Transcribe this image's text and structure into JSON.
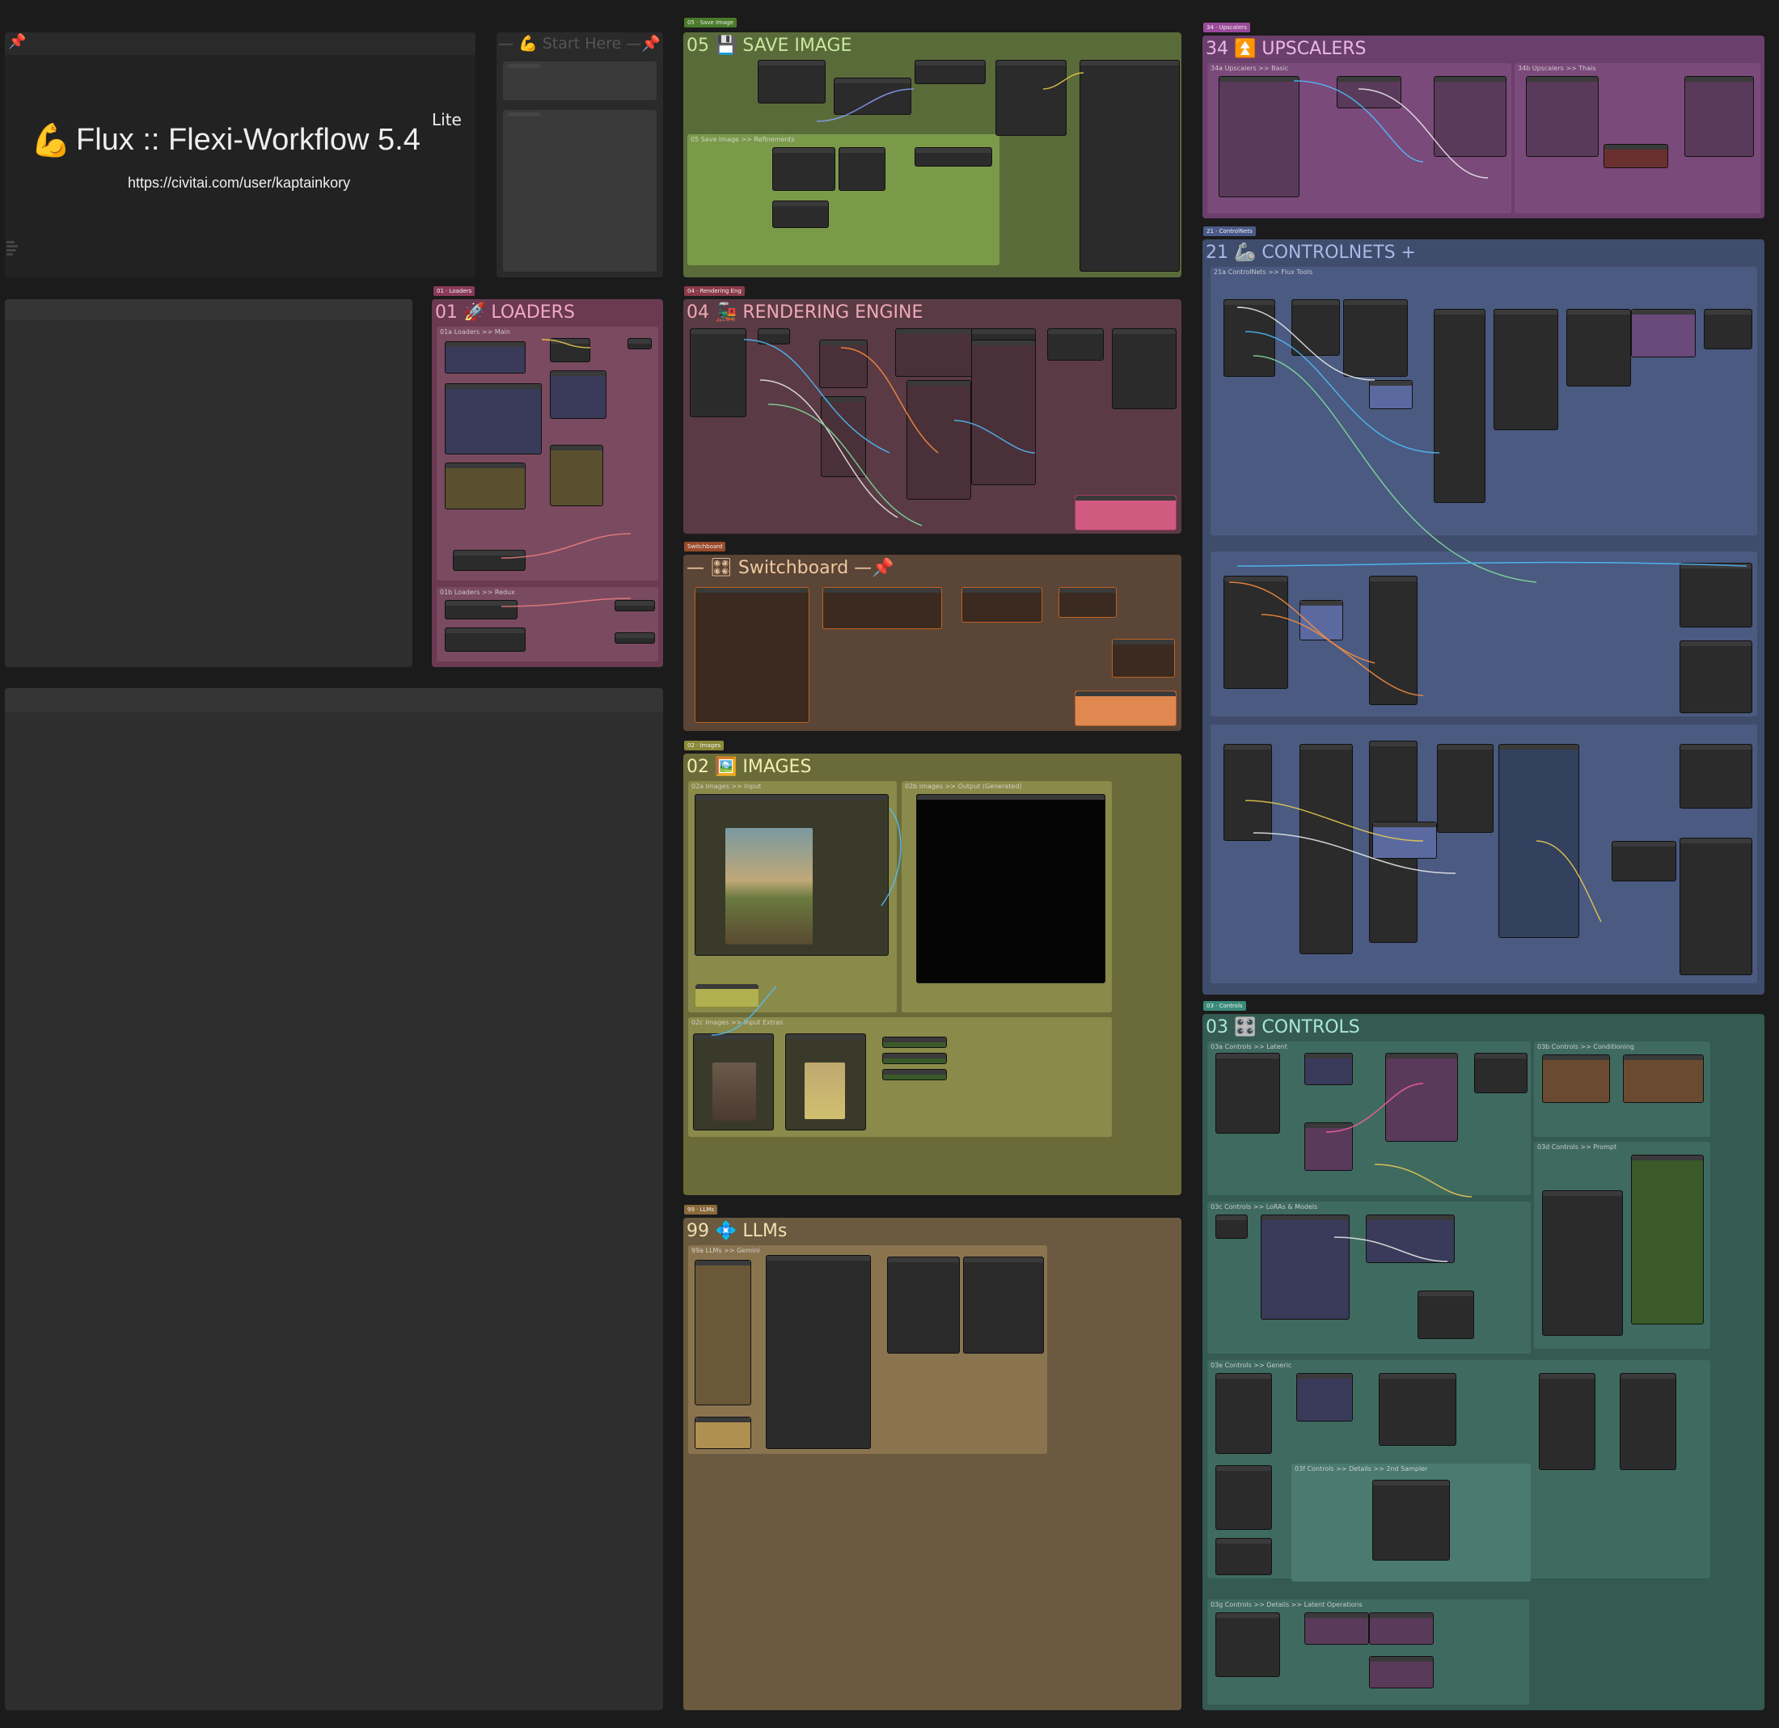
{
  "title_card": {
    "pin": "📌",
    "emoji": "💪",
    "title": "Flux :: Flexi-Workflow 5.4",
    "edition": "Lite",
    "url": "https://civitai.com/user/kaptainkory"
  },
  "start_here": {
    "label": "— 💪 Start Here —📌"
  },
  "groups": {
    "save_image": {
      "title": "05 💾 SAVE IMAGE",
      "sub1": "05 Save Image >> Refinements"
    },
    "upscalers": {
      "title": "34 ⏫ UPSCALERS",
      "sub1": "34a Upscalers >> Basic",
      "sub2": "34b Upscalers >> Thais"
    },
    "controlnets": {
      "title": "21 🦾 CONTROLNETS +",
      "sub1": "21a ControlNets >> Flux Tools"
    },
    "loaders": {
      "title": "01 🚀 LOADERS",
      "sub1": "01a Loaders >> Main",
      "sub2": "01b Loaders >> Redux"
    },
    "rendering": {
      "title": "04 🚂 RENDERING ENGINE"
    },
    "switchboard": {
      "title": "— 🎛 Switchboard —📌"
    },
    "images": {
      "title": "02 🖼️ IMAGES",
      "sub1": "02a Images >> Input",
      "sub2": "02b Images >> Output (Generated)",
      "sub3": "02c Images >> Input Extras"
    },
    "llms": {
      "title": "99 💠 LLMs",
      "sub1": "99a LLMs >> Gemini"
    },
    "controls": {
      "title": "03 🎛️ CONTROLS",
      "sub1": "03a Controls >> Latent",
      "sub2": "03b Controls >> Conditioning",
      "sub3": "03c Controls >> LoRAs & Models",
      "sub4": "03d Controls >> Prompt",
      "sub5": "03e Controls >> Generic",
      "sub6": "03f Controls >> Details >> 2nd Sampler",
      "sub7": "03g Controls >> Details >> Latent Operations"
    }
  },
  "tabs": {
    "save_image": "05 · Save Image",
    "upscalers": "34 · Upscalers",
    "controlnets": "21 · ControlNets",
    "loaders": "01 · Loaders",
    "rendering": "04 · Rendering Eng",
    "switchboard": "Switchboard",
    "images": "02 · Images",
    "llms": "99 · LLMs",
    "controls": "03 · Controls"
  },
  "colors": {
    "canvas": "#1b1b1b",
    "save_image": "#5a6b3a",
    "upscalers": "#6b3f6b",
    "controlnets": "#3f4c6b",
    "loaders": "#6b3a52",
    "rendering": "#5a3a45",
    "switchboard": "#5a4536",
    "images": "#6b6b3a",
    "llms": "#6b5a3f",
    "controls": "#355a52"
  }
}
